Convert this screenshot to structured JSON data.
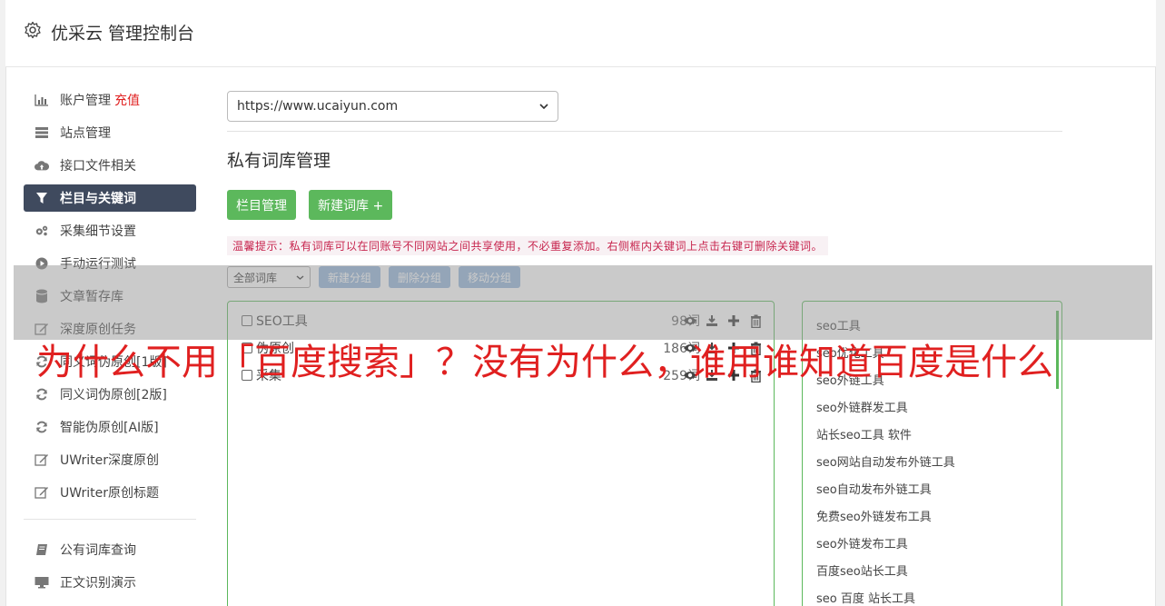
{
  "app": {
    "title": "优采云 管理控制台"
  },
  "sidebar": {
    "items": [
      {
        "label": "账户管理",
        "badge": "充值",
        "icon": "bar-chart-icon"
      },
      {
        "label": "站点管理",
        "icon": "server-icon"
      },
      {
        "label": "接口文件相关",
        "icon": "cloud-upload-icon"
      },
      {
        "label": "栏目与关键词",
        "icon": "filter-icon",
        "active": true
      },
      {
        "label": "采集细节设置",
        "icon": "gears-icon"
      },
      {
        "label": "手动运行测试",
        "icon": "play-circle-icon"
      },
      {
        "label": "文章暂存库",
        "icon": "database-icon"
      },
      {
        "label": "深度原创任务",
        "icon": "edit-icon"
      },
      {
        "label": "同义词伪原创[1版]",
        "icon": "refresh-icon"
      },
      {
        "label": "同义词伪原创[2版]",
        "icon": "refresh-icon"
      },
      {
        "label": "智能伪原创[AI版]",
        "icon": "refresh-icon"
      },
      {
        "label": "UWriter深度原创",
        "icon": "edit-icon"
      },
      {
        "label": "UWriter原创标题",
        "icon": "edit-icon"
      }
    ],
    "items2": [
      {
        "label": "公有词库查询",
        "icon": "book-icon"
      },
      {
        "label": "正文识别演示",
        "icon": "monitor-icon"
      }
    ]
  },
  "main": {
    "site_select": "https://www.ucaiyun.com",
    "page_title": "私有词库管理",
    "buttons": {
      "category": "栏目管理",
      "new_lib": "新建词库 +"
    },
    "tip": "温馨提示：私有词库可以在同账号不同网站之间共享使用，不必重复添加。右侧框内关键词上点击右键可删除关键词。",
    "toolbar": {
      "filter_select": "全部词库",
      "new_group": "新建分组",
      "delete_group": "删除分组",
      "move_group": "移动分组"
    },
    "groups": [
      {
        "name": "SEO工具",
        "count": "98词"
      },
      {
        "name": "伪原创",
        "count": "186词"
      },
      {
        "name": "采集",
        "count": "259词"
      }
    ],
    "keywords": [
      "seo工具",
      "seo优化工具",
      "seo外链工具",
      "seo外链群发工具",
      "站长seo工具 软件",
      "seo网站自动发布外链工具",
      "seo自动发布外链工具",
      "免费seo外链发布工具",
      "seo外链发布工具",
      "百度seo站长工具",
      "seo 百度 站长工具"
    ]
  },
  "overlay_headline": "为什么不用「百度搜索」？没有为什么，谁用谁知道百度是什么",
  "colors": {
    "green": "#5cb85c",
    "active_bg": "#3f4a5e",
    "red": "#e02020",
    "blue_btn": "#7fa8d4"
  }
}
